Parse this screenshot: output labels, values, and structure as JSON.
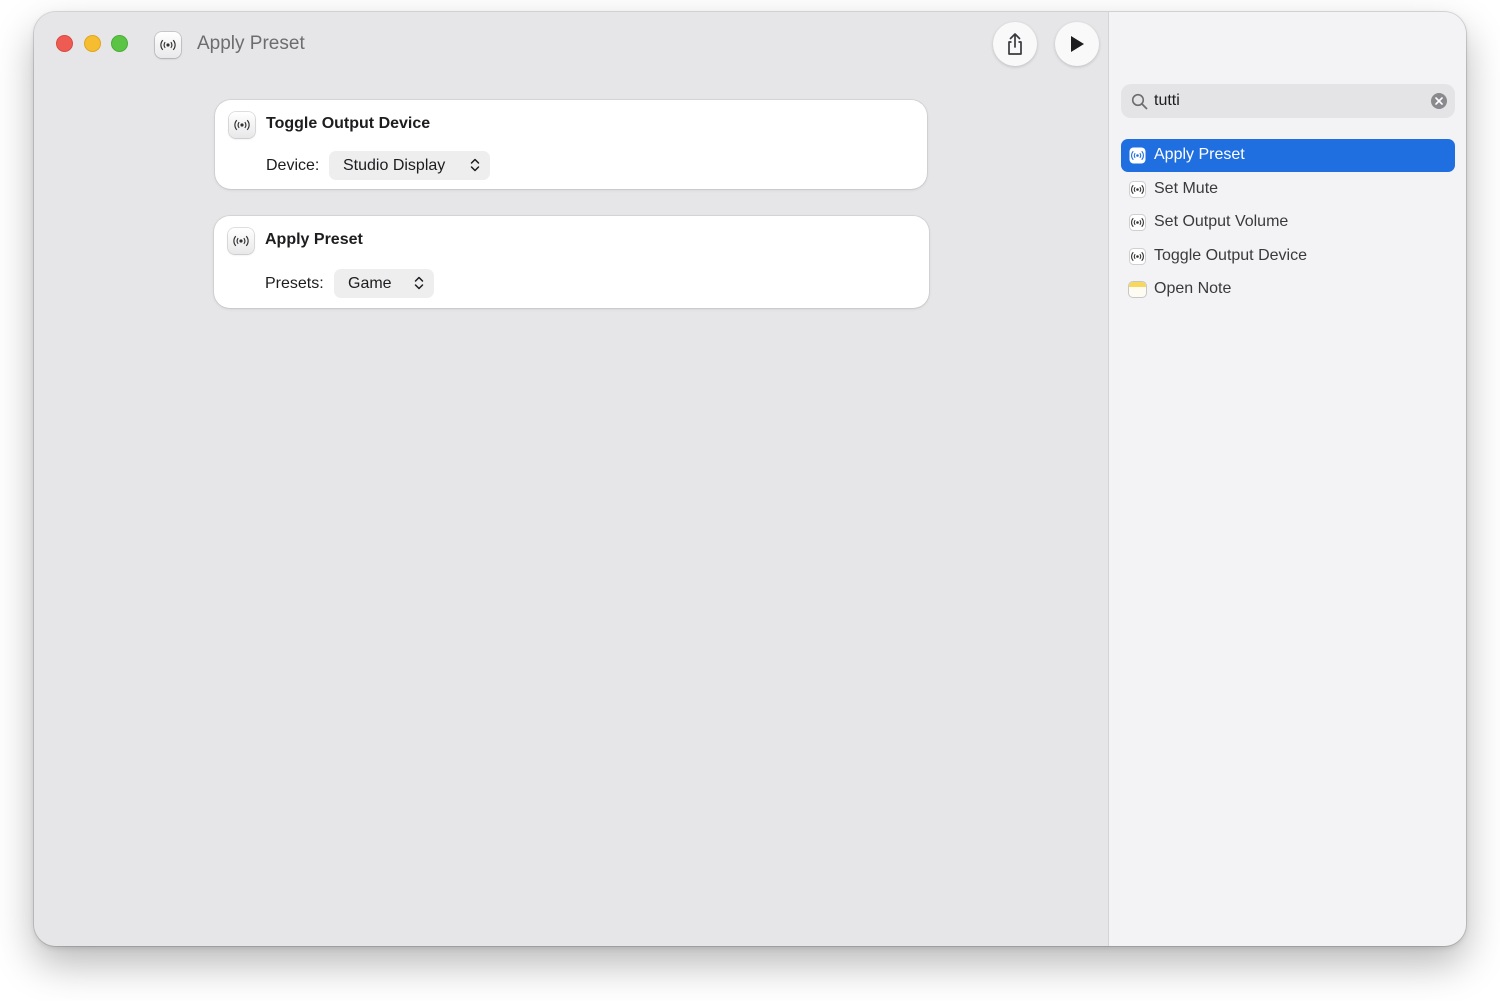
{
  "window": {
    "title": "Apply Preset"
  },
  "toolbar": {
    "share_icon": "share-icon",
    "run_icon": "play-icon",
    "segments": [
      "library-icon",
      "info-icon"
    ]
  },
  "actions": [
    {
      "title": "Toggle Output Device",
      "param_label": "Device:",
      "param_value": "Studio Display"
    },
    {
      "title": "Apply Preset",
      "param_label": "Presets:",
      "param_value": "Game"
    }
  ],
  "sidebar": {
    "search": {
      "value": "tutti"
    },
    "results": [
      {
        "label": "Apply Preset",
        "icon": "broadcast-icon",
        "selected": true
      },
      {
        "label": "Set Mute",
        "icon": "broadcast-icon"
      },
      {
        "label": "Set Output Volume",
        "icon": "broadcast-icon"
      },
      {
        "label": "Toggle Output Device",
        "icon": "broadcast-icon"
      },
      {
        "label": "Open Note",
        "icon": "note-icon"
      }
    ]
  },
  "colors": {
    "selection": "#1f6fe0",
    "close": "#ee5b52",
    "minimize": "#f5bd2f",
    "zoom": "#5cc445"
  }
}
